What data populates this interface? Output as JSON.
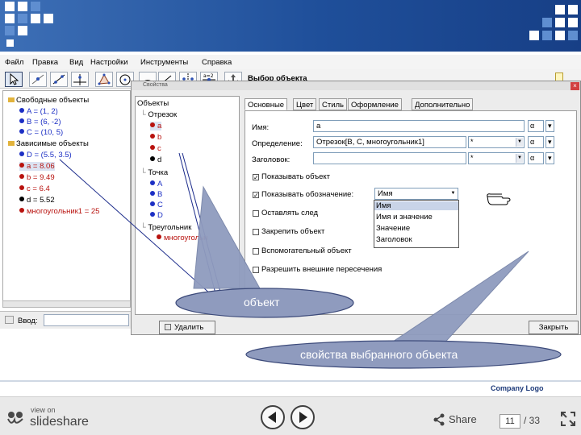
{
  "menu": [
    "Файл",
    "Правка",
    "Вид",
    "Настройки",
    "Инструменты",
    "Справка"
  ],
  "toolbar": {
    "title": "Выбор объекта",
    "tool_icons": [
      "move-tool",
      "point-tool",
      "line-tool",
      "perpendicular-tool",
      "polygon-tool",
      "circle-tool",
      "angle-tool",
      "reflect-tool",
      "slider-tool",
      "move-view-tool"
    ]
  },
  "algebra": {
    "free_header": "Свободные объекты",
    "free": [
      "A = (1, 2)",
      "B = (6, -2)",
      "C = (10, 5)"
    ],
    "dep_header": "Зависимые объекты",
    "dep": [
      {
        "text": "D = (5.5, 3.5)",
        "color": "#1c2fc4"
      },
      {
        "text": "a = 8.06",
        "color": "#b8120e"
      },
      {
        "text": "b = 9.49",
        "color": "#b8120e"
      },
      {
        "text": "c = 6.4",
        "color": "#b8120e"
      },
      {
        "text": "d = 5.52",
        "color": "#000000"
      },
      {
        "text": "многоугольник1 = 25",
        "color": "#b8120e"
      }
    ]
  },
  "input": {
    "label": "Ввод:"
  },
  "dialog": {
    "title": "Свойства",
    "tree_root": "Объекты",
    "group_segment": "Отрезок",
    "segments": [
      "a",
      "b",
      "c",
      "d"
    ],
    "group_point": "Точка",
    "points": [
      "A",
      "B",
      "C",
      "D"
    ],
    "group_triangle": "Треугольник",
    "triangle": "многоугольн",
    "tabs": [
      "Основные",
      "Цвет",
      "Стиль",
      "Оформление",
      "Дополнительно"
    ],
    "labels": {
      "name": "Имя:",
      "definition": "Определение:",
      "caption": "Заголовок:"
    },
    "values": {
      "name": "a",
      "definition": "Отрезок[B, C, многоугольник1]",
      "caption": ""
    },
    "checks": {
      "show_object": "Показывать объект",
      "show_label": "Показывать обозначение:",
      "trace": "Оставлять след",
      "fix": "Закрепить объект",
      "auxiliary": "Вспомогательный объект",
      "intersections": "Разрешить внешние пересечения"
    },
    "label_select": "Имя",
    "label_options": [
      "Имя",
      "Имя и значение",
      "Значение",
      "Заголовок"
    ],
    "buttons": {
      "delete": "Удалить",
      "close": "Закрыть"
    }
  },
  "annotations": {
    "object": "объект",
    "properties": "свойства выбранного объекта"
  },
  "footer": {
    "company_logo": "Company Logo",
    "view_on": "view on",
    "brand": "slideshare",
    "share": "Share",
    "page_current": "11",
    "page_total": "/ 33"
  },
  "colors": {
    "header_blue": "#1f4f9a",
    "callout_fill": "#8f9bbe",
    "free_blue": "#1c2fc4",
    "dependent_red": "#b8120e"
  }
}
